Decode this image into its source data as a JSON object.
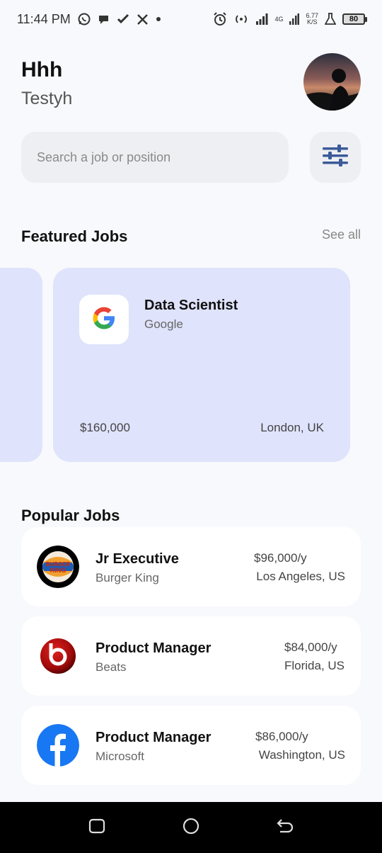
{
  "status_bar": {
    "time": "11:44 PM",
    "network_type": "4G",
    "net_speed_value": "6.77",
    "net_speed_unit": "K/S",
    "battery": "80"
  },
  "header": {
    "name": "Hhh",
    "subtitle": "Testyh"
  },
  "search": {
    "placeholder": "Search a job or position"
  },
  "featured": {
    "title": "Featured Jobs",
    "see_all": "See all",
    "card": {
      "title": "Data Scientist",
      "company": "Google",
      "salary": "$160,000",
      "location": "London, UK",
      "logo_icon": "google-logo-icon"
    }
  },
  "popular": {
    "title": "Popular Jobs",
    "items": [
      {
        "title": "Jr Executive",
        "company": "Burger King",
        "salary": "$96,000/y",
        "location": "Los Angeles, US",
        "logo_icon": "burger-king-logo-icon",
        "logo_text": "BURGER KING"
      },
      {
        "title": "Product Manager",
        "company": "Beats",
        "salary": "$84,000/y",
        "location": "Florida, US",
        "logo_icon": "beats-logo-icon"
      },
      {
        "title": "Product Manager",
        "company": "Microsoft",
        "salary": "$86,000/y",
        "location": "Washington, US",
        "logo_icon": "facebook-logo-icon"
      }
    ]
  },
  "colors": {
    "background": "#f8f9fc",
    "featured_card": "#dfe3fb",
    "filter_icon": "#3b5b9a"
  }
}
